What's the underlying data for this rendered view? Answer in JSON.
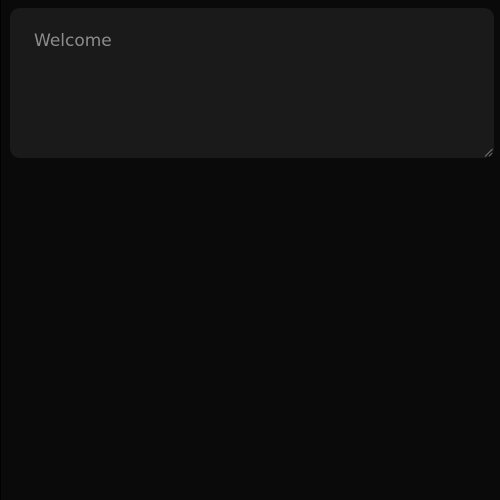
{
  "message_box": {
    "placeholder": "Welcome",
    "value": ""
  },
  "colors": {
    "page_background": "#0a0a0a",
    "field_background": "#1a1a1a",
    "placeholder_text": "#8c8c8c"
  },
  "icons": {
    "resize_grip": "resize-grip-icon"
  }
}
